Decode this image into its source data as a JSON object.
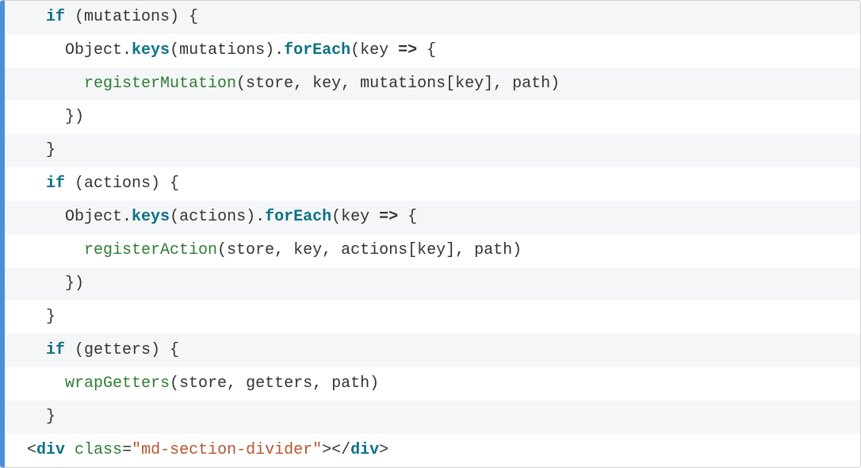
{
  "code": {
    "lines": [
      {
        "indent": 1,
        "tokens": [
          {
            "text": "if",
            "cls": "tok-keyword"
          },
          {
            "text": " (mutations) {",
            "cls": "tok-punct"
          }
        ]
      },
      {
        "indent": 2,
        "tokens": [
          {
            "text": "Object",
            "cls": "tok-ident"
          },
          {
            "text": ".",
            "cls": "tok-punct"
          },
          {
            "text": "keys",
            "cls": "tok-method"
          },
          {
            "text": "(mutations).",
            "cls": "tok-punct"
          },
          {
            "text": "forEach",
            "cls": "tok-method"
          },
          {
            "text": "(key ",
            "cls": "tok-punct"
          },
          {
            "text": "=>",
            "cls": "tok-arrow"
          },
          {
            "text": " {",
            "cls": "tok-punct"
          }
        ]
      },
      {
        "indent": 3,
        "tokens": [
          {
            "text": "registerMutation",
            "cls": "tok-func"
          },
          {
            "text": "(store, key, mutations[key], path)",
            "cls": "tok-punct"
          }
        ]
      },
      {
        "indent": 2,
        "tokens": [
          {
            "text": "})",
            "cls": "tok-punct"
          }
        ]
      },
      {
        "indent": 1,
        "tokens": [
          {
            "text": "}",
            "cls": "tok-punct"
          }
        ]
      },
      {
        "indent": 1,
        "tokens": [
          {
            "text": "if",
            "cls": "tok-keyword"
          },
          {
            "text": " (actions) {",
            "cls": "tok-punct"
          }
        ]
      },
      {
        "indent": 2,
        "tokens": [
          {
            "text": "Object",
            "cls": "tok-ident"
          },
          {
            "text": ".",
            "cls": "tok-punct"
          },
          {
            "text": "keys",
            "cls": "tok-method"
          },
          {
            "text": "(actions).",
            "cls": "tok-punct"
          },
          {
            "text": "forEach",
            "cls": "tok-method"
          },
          {
            "text": "(key ",
            "cls": "tok-punct"
          },
          {
            "text": "=>",
            "cls": "tok-arrow"
          },
          {
            "text": " {",
            "cls": "tok-punct"
          }
        ]
      },
      {
        "indent": 3,
        "tokens": [
          {
            "text": "registerAction",
            "cls": "tok-func"
          },
          {
            "text": "(store, key, actions[key], path)",
            "cls": "tok-punct"
          }
        ]
      },
      {
        "indent": 2,
        "tokens": [
          {
            "text": "})",
            "cls": "tok-punct"
          }
        ]
      },
      {
        "indent": 1,
        "tokens": [
          {
            "text": "}",
            "cls": "tok-punct"
          }
        ]
      },
      {
        "indent": 1,
        "tokens": [
          {
            "text": "if",
            "cls": "tok-keyword"
          },
          {
            "text": " (getters) {",
            "cls": "tok-punct"
          }
        ]
      },
      {
        "indent": 2,
        "tokens": [
          {
            "text": "wrapGetters",
            "cls": "tok-func"
          },
          {
            "text": "(store, getters, path)",
            "cls": "tok-punct"
          }
        ]
      },
      {
        "indent": 1,
        "tokens": [
          {
            "text": "}",
            "cls": "tok-punct"
          }
        ]
      },
      {
        "indent": 0,
        "tokens": [
          {
            "text": "<",
            "cls": "tok-punct"
          },
          {
            "text": "div",
            "cls": "tok-tag"
          },
          {
            "text": " ",
            "cls": "tok-punct"
          },
          {
            "text": "class",
            "cls": "tok-attr"
          },
          {
            "text": "=",
            "cls": "tok-punct"
          },
          {
            "text": "\"md-section-divider\"",
            "cls": "tok-string"
          },
          {
            "text": "></",
            "cls": "tok-punct"
          },
          {
            "text": "div",
            "cls": "tok-tag"
          },
          {
            "text": ">",
            "cls": "tok-punct"
          }
        ]
      }
    ]
  }
}
